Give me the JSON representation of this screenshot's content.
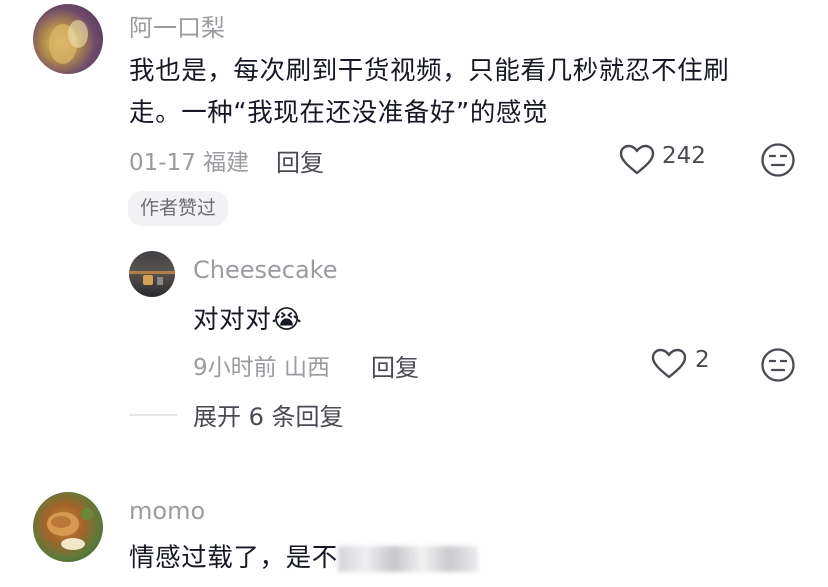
{
  "comments": [
    {
      "username": "阿一口梨",
      "text_line1": "我也是，每次刷到干货视频，只能看几秒就忍不住刷",
      "text_line2": "走。一种“我现在还没准备好”的感觉",
      "date_location": "01-17 福建",
      "reply_label": "回复",
      "likes": "242",
      "badge": "作者赞过",
      "avatar_icon": "profile-photo-icon",
      "like_icon": "heart-outline-icon",
      "emoji_icon": "dislike-face-icon"
    },
    {
      "username": "Cheesecake",
      "text": "对对对",
      "emoji": "😭",
      "date_location": "9小时前 山西",
      "reply_label": "回复",
      "likes": "2",
      "avatar_icon": "profile-photo-icon",
      "like_icon": "heart-outline-icon",
      "emoji_icon": "dislike-face-icon"
    },
    {
      "username": "momo",
      "text": "情感过载了，是不",
      "avatar_icon": "profile-photo-icon"
    }
  ],
  "expand_replies": "展开 6 条回复",
  "colors": {
    "text_primary": "#161823",
    "text_secondary": "#9b9ba0",
    "badge_bg": "#f2f2f4"
  }
}
